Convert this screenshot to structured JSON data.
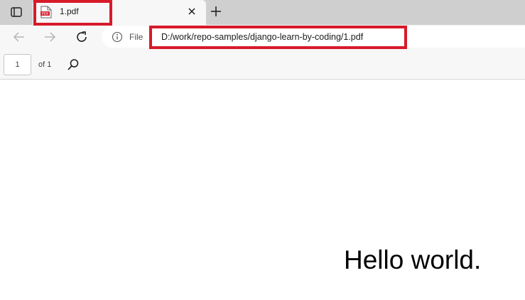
{
  "window": {
    "tab": {
      "title": "1.pdf",
      "favicon": "pdf-file-icon"
    },
    "icons": {
      "tab_actions": "tab-actions-icon",
      "close": "close-icon",
      "new_tab": "plus-icon"
    }
  },
  "toolbar": {
    "icons": {
      "back": "arrow-left-icon",
      "forward": "arrow-right-icon",
      "reload": "reload-icon",
      "info": "info-icon"
    },
    "site_label": "File",
    "url": "D:/work/repo-samples/django-learn-by-coding/1.pdf"
  },
  "pdf_toolbar": {
    "page_number": "1",
    "page_count": "of 1",
    "search_icon": "search-icon"
  },
  "document": {
    "text": "Hello world."
  },
  "colors": {
    "highlight": "#d71a2a",
    "tabstrip": "#cfcfcf",
    "toolbar": "#f7f7f7"
  }
}
